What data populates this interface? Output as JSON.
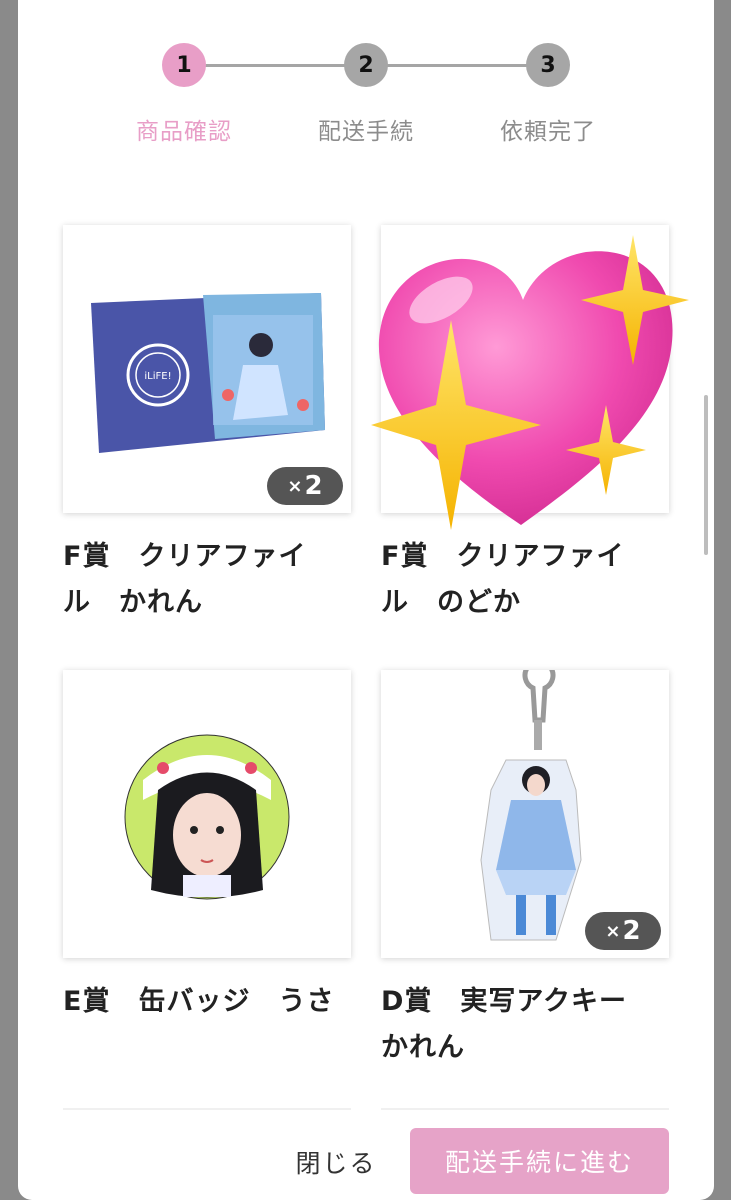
{
  "stepper": {
    "steps": [
      {
        "number": "1",
        "label": "商品確認",
        "active": true
      },
      {
        "number": "2",
        "label": "配送手続",
        "active": false
      },
      {
        "number": "3",
        "label": "依頼完了",
        "active": false
      }
    ]
  },
  "items": [
    {
      "title": "F賞　クリアファイル　かれん",
      "title_line1": "F賞　クリアファイ",
      "title_line2": "ル　かれん",
      "qty_x": "×",
      "qty": "2",
      "image": "clear-file-karen"
    },
    {
      "title": "F賞　クリアファイル　のどか",
      "title_line1": "F賞　クリアファイ",
      "title_line2": "ル　のどか",
      "image": "sparkling-heart-emoji"
    },
    {
      "title": "E賞　缶バッジ　うさ",
      "title_line1": "E賞　缶バッジ　うさ",
      "title_line2": "",
      "image": "can-badge-usa"
    },
    {
      "title": "D賞　実写アクキー　かれん",
      "title_line1": "D賞　実写アクキー",
      "title_line2": "かれん",
      "qty_x": "×",
      "qty": "2",
      "image": "acrylic-keychain-karen"
    }
  ],
  "footer": {
    "close_label": "閉じる",
    "proceed_label": "配送手続に進む"
  },
  "colors": {
    "accent": "#e89ec7",
    "button": "#e6a3c8",
    "inactive": "#a6a6a6",
    "badge": "#555555"
  }
}
